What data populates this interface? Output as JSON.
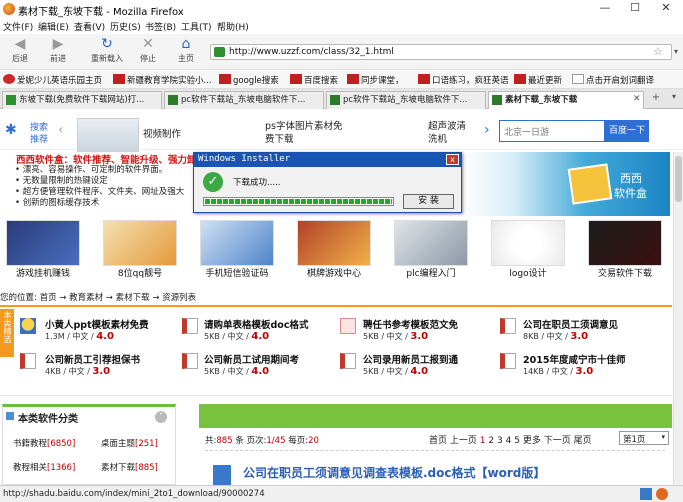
{
  "window": {
    "title": "素材下载_东坡下载 - Mozilla Firefox",
    "min": "—",
    "max": "☐",
    "close": "✕"
  },
  "menu": [
    "文件(F)",
    "编辑(E)",
    "查看(V)",
    "历史(S)",
    "书签(B)",
    "工具(T)",
    "帮助(H)"
  ],
  "nav": {
    "back": "后退",
    "forward": "前进",
    "reload": "重新载入",
    "stop": "停止",
    "home": "主页"
  },
  "url": "http://www.uzzf.com/class/32_1.html",
  "bookmarks": [
    "爱妮少儿英语乐园主页",
    "新疆教育学院实验小...",
    "google搜索",
    "百度搜索",
    "同步课堂，",
    "口语练习，疯狂英语",
    "最近更新",
    "点击开启划词翻译"
  ],
  "tabs": [
    "东坡下载(免费软件下载网站)打...",
    "pc软件下载站_东坡电脑软件下...",
    "pc软件下载站_东坡电脑软件下...",
    "素材下载_东坡下载"
  ],
  "banner": {
    "search_label_1": "搜索",
    "search_label_2": "推荐",
    "video": "视频制作",
    "ps_1": "ps字体图片素材免",
    "ps_2": "费下载",
    "clean_1": "超声波清",
    "clean_2": "洗机",
    "search_placeholder": "北京一日游",
    "search_button": "百度一下"
  },
  "promo": {
    "title": "西西软件盒：软件推荐、智能升级、强力卸",
    "lines": [
      "• 漂亮、容易操作、可定制的软件界面。",
      "• 无数量限制的热键设定",
      "• 超方便管理软件程序、文件夹、网址及强大",
      "• 创新的图标缓存技术"
    ],
    "box_1": "西西",
    "box_2": "软件盒"
  },
  "dialog": {
    "title": "Windows Installer",
    "message": "下载成功.....",
    "button": "安 装",
    "close": "x",
    "progress": 1.0
  },
  "software": [
    "游戏挂机赚钱",
    "8位qq靓号",
    "手机短信验证码",
    "棋牌游戏中心",
    "plc编程入门",
    "logo设计",
    "交易软件下载"
  ],
  "breadcrumb": "您的位置: 首页 → 教育素材 → 素材下载 → 资源列表",
  "featured_badge": "本类精选",
  "items": [
    {
      "title": "小黄人ppt模板素材免费",
      "size": "1.3M",
      "lang": "中文",
      "score": "4.0"
    },
    {
      "title": "请购单表格模板doc格式",
      "size": "5KB",
      "lang": "中文",
      "score": "4.0"
    },
    {
      "title": "聘任书参考模板范文免",
      "size": "5KB",
      "lang": "中文",
      "score": "3.0"
    },
    {
      "title": "公司在职员工须调意见",
      "size": "8KB",
      "lang": "中文",
      "score": "3.0"
    },
    {
      "title": "公司新员工引荐担保书",
      "size": "4KB",
      "lang": "中文",
      "score": "3.0"
    },
    {
      "title": "公司新员工试用期间考",
      "size": "5KB",
      "lang": "中文",
      "score": "4.0"
    },
    {
      "title": "公司录用新员工报到通",
      "size": "5KB",
      "lang": "中文",
      "score": "4.0"
    },
    {
      "title": "2015年度咸宁市十佳师",
      "size": "14KB",
      "lang": "中文",
      "score": "3.0"
    }
  ],
  "sidebar": {
    "title": "本类软件分类",
    "cats": [
      [
        "书籍教程",
        "[6850]"
      ],
      [
        "桌面主题",
        "[251]"
      ],
      [
        "教程相关",
        "[1366]"
      ],
      [
        "素材下载",
        "[885]"
      ]
    ]
  },
  "pager": {
    "summary_prefix": "共:",
    "total": "885",
    "summary_mid": "条 页次:",
    "page": "1/45",
    "summary_per": "每页:",
    "per": "20",
    "links": [
      "首页",
      "上一页",
      "1",
      "2",
      "3",
      "4",
      "5",
      "更多",
      "下一页",
      "尾页"
    ],
    "select": "第1页"
  },
  "list_first": "公司在职员工须调意见调查表模板.doc格式【word版】",
  "status": "http://shadu.baidu.com/index/mini_2to1_download/90000274"
}
